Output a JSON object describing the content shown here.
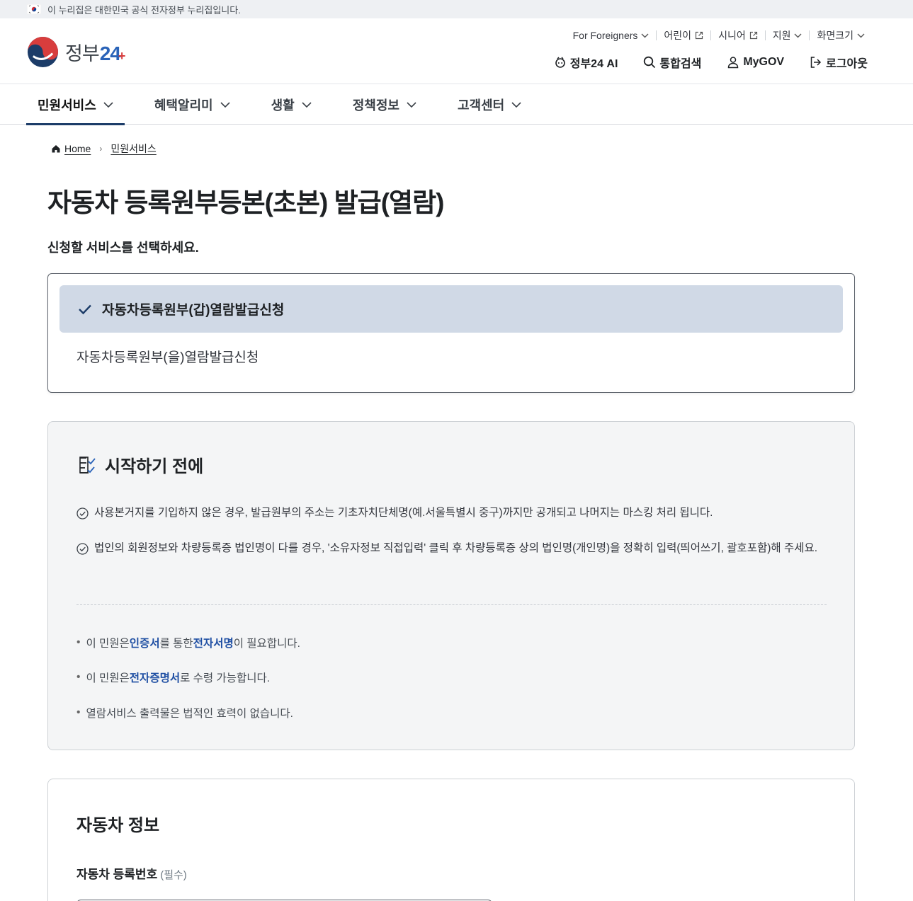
{
  "banner": {
    "text": "이 누리집은 대한민국 공식 전자정부 누리집입니다."
  },
  "logo": {
    "text": "정부",
    "number": "24",
    "plus": "+"
  },
  "utility_links": [
    {
      "label": "For Foreigners",
      "icon": "chevron-down-icon"
    },
    {
      "label": "어린이",
      "icon": "external-link-icon"
    },
    {
      "label": "시니어",
      "icon": "external-link-icon"
    },
    {
      "label": "지원",
      "icon": "chevron-down-icon"
    },
    {
      "label": "화면크기",
      "icon": "chevron-down-icon"
    }
  ],
  "actions": {
    "ai": "정부24 AI",
    "search": "통합검색",
    "mygov": "MyGOV",
    "logout": "로그아웃"
  },
  "nav": [
    {
      "label": "민원서비스",
      "active": true
    },
    {
      "label": "혜택알리미"
    },
    {
      "label": "생활"
    },
    {
      "label": "정책정보"
    },
    {
      "label": "고객센터"
    }
  ],
  "breadcrumb": {
    "home": "Home",
    "current": "민원서비스"
  },
  "page_title": "자동차 등록원부등본(초본) 발급(열람)",
  "sub_title": "신청할 서비스를 선택하세요.",
  "service_options": {
    "selected": "자동차등록원부(갑)열람발급신청",
    "other": "자동차등록원부(을)열람발급신청"
  },
  "before_start": {
    "title": "시작하기 전에",
    "checks": [
      "사용본거지를 기입하지 않은 경우, 발급원부의 주소는 기초자치단체명(예.서울특별시 중구)까지만 공개되고 나머지는 마스킹 처리 됩니다.",
      "법인의 회원정보와 차량등록증 법인명이 다를 경우, '소유자정보 직접입력' 클릭 후 차량등록증 상의 법인명(개인명)을 정확히 입력(띄어쓰기, 괄호포함)해 주세요."
    ],
    "notes": {
      "n1_a": "이 민원은 ",
      "n1_b": "인증서",
      "n1_c": "를 통한 ",
      "n1_d": "전자서명",
      "n1_e": "이 필요합니다.",
      "n2_a": "이 민원은 ",
      "n2_b": "전자증명서",
      "n2_c": "로 수령 가능합니다.",
      "n3": "열람서비스 출력물은 법적인 효력이 없습니다."
    }
  },
  "vehicle": {
    "title": "자동차 정보",
    "reg_label": "자동차 등록번호",
    "required": "(필수)"
  },
  "colors": {
    "brand_navy": "#1c3c68",
    "selected_bg": "#d0d9e6",
    "highlight_blue": "#1f4fa3"
  }
}
